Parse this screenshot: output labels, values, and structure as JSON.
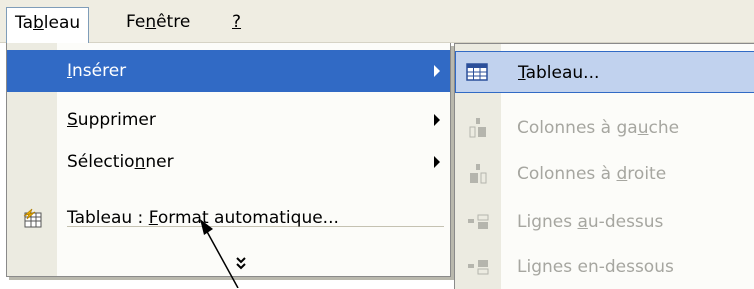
{
  "menubar": {
    "items": [
      {
        "label": "Tableau"
      },
      {
        "label": "Fenêtre"
      },
      {
        "label": "?"
      }
    ]
  },
  "menu": {
    "items": [
      {
        "label": "Insérer"
      },
      {
        "label": "Supprimer"
      },
      {
        "label": "Sélectionner"
      },
      {
        "label": "Tableau : Format automatique..."
      }
    ],
    "more_glyph": "»"
  },
  "submenu": {
    "items": [
      {
        "label": "Tableau..."
      },
      {
        "label": "Colonnes à gauche"
      },
      {
        "label": "Colonnes à droite"
      },
      {
        "label": "Lignes au-dessus"
      },
      {
        "label": "Lignes en-dessous"
      }
    ]
  },
  "colors": {
    "highlight": "#316ac5",
    "hover": "#c1d2ee",
    "disabled": "#a6a6a0"
  }
}
